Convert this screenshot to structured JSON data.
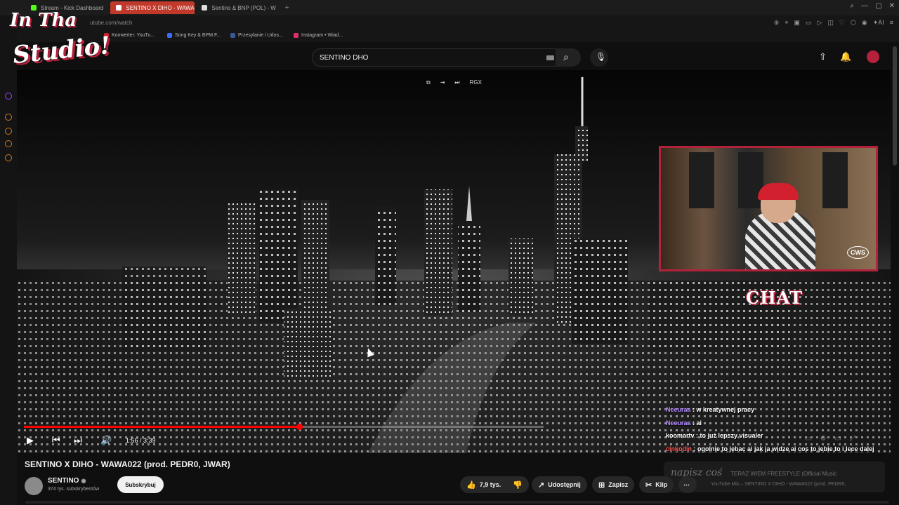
{
  "browser": {
    "tabs": [
      {
        "label": "Stream - Kick Dashboard",
        "color": "#53fc18",
        "active": false
      },
      {
        "label": "SENTINO X DIHO - WAWA",
        "color": "#ff0000",
        "active": true
      },
      {
        "label": "Sentino & BNP (POL) - W",
        "color": "#dddddd",
        "active": false
      }
    ],
    "new_tab": "+",
    "url": "utube.com/watch",
    "bookmarks": [
      {
        "label": "Konwerter: YouTu...",
        "color": "#d2202e"
      },
      {
        "label": "Song Key & BPM F...",
        "color": "#3b6cff"
      },
      {
        "label": "Przesylanie i Udos...",
        "color": "#3b5998"
      },
      {
        "label": "Instagram • Wiad...",
        "color": "#e1306c"
      }
    ]
  },
  "youtube": {
    "search_value": "SENTINO DHO",
    "mini_controls": [
      "⧉",
      "⇥",
      "⏭",
      "RGX"
    ],
    "player": {
      "time": "1:56 / 3:39",
      "progress_fraction": 0.53
    },
    "video_title": "SENTINO X DIHO - WAWA022 (prod. PEDR0, JWAR)",
    "channel": {
      "name": "SENTINO",
      "verified": "◉",
      "subscribers": "374 tys. subskrybentów",
      "subscribe_label": "Subskrybuj"
    },
    "actions": {
      "likes": "7,9 tys.",
      "share": "Udostępnij",
      "save": "Zapisz",
      "clip": "Klip",
      "more": "⋯"
    }
  },
  "overlay": {
    "logo_line1": "In Tha",
    "logo_line2": "Studio!",
    "chat_title": "CHAT",
    "cam_logo": "CWS",
    "chat_messages": [
      {
        "user": "Neeuraa",
        "user_color": "#b48cff",
        "text": " : w kreatywnej pracy"
      },
      {
        "user": "Neeuraa",
        "user_color": "#b48cff",
        "text": " : ai"
      },
      {
        "user": "koomartv",
        "user_color": "#ffffff",
        "text": " : to już lepszy visualer"
      },
      {
        "user": "cinkodin",
        "user_color": "#ff5a5a",
        "text": " : ogolnie to jebac ai jak ja widze ai cos to jebie to i lece dalej"
      }
    ],
    "chat_placeholder": "napisz coś",
    "mix_line1": "TERAZ WIEM FREESTYLE (Official Music",
    "mix_line2": "YouTube Mix – SENTINO X DIHO - WAWA022 (prod. PEDR0,"
  }
}
